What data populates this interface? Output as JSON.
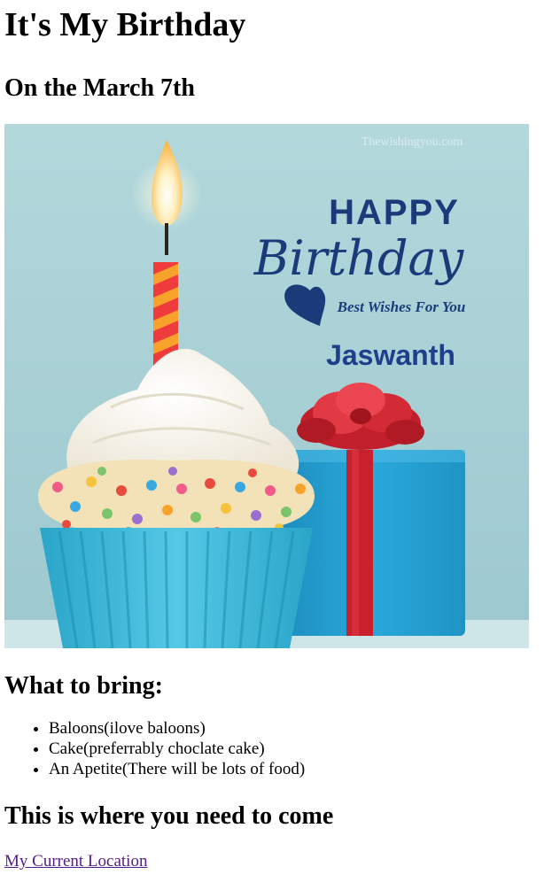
{
  "page": {
    "title": "It's My Birthday",
    "subtitle": "On the March 7th"
  },
  "image": {
    "watermark": "Thewishingyou.com",
    "happy": "HAPPY",
    "birthday": "Birthday",
    "wishes": "Best Wishes For You",
    "name": "Jaswanth"
  },
  "bring": {
    "heading": "What to bring:",
    "items": [
      "Baloons(ilove baloons)",
      "Cake(preferrably choclate cake)",
      "An Apetite(There will be lots of food)"
    ]
  },
  "location": {
    "heading": "This is where you need to come",
    "link_label": "My Current Location"
  },
  "colors": {
    "background": "#ffffff",
    "text": "#000000",
    "link": "#551a8b",
    "image_bg": "#a9d1d6",
    "title_navy": "#1a3a7a",
    "cup_blue": "#3ab6d8",
    "gift_blue": "#2a9fd0",
    "ribbon_red": "#c8202c"
  }
}
